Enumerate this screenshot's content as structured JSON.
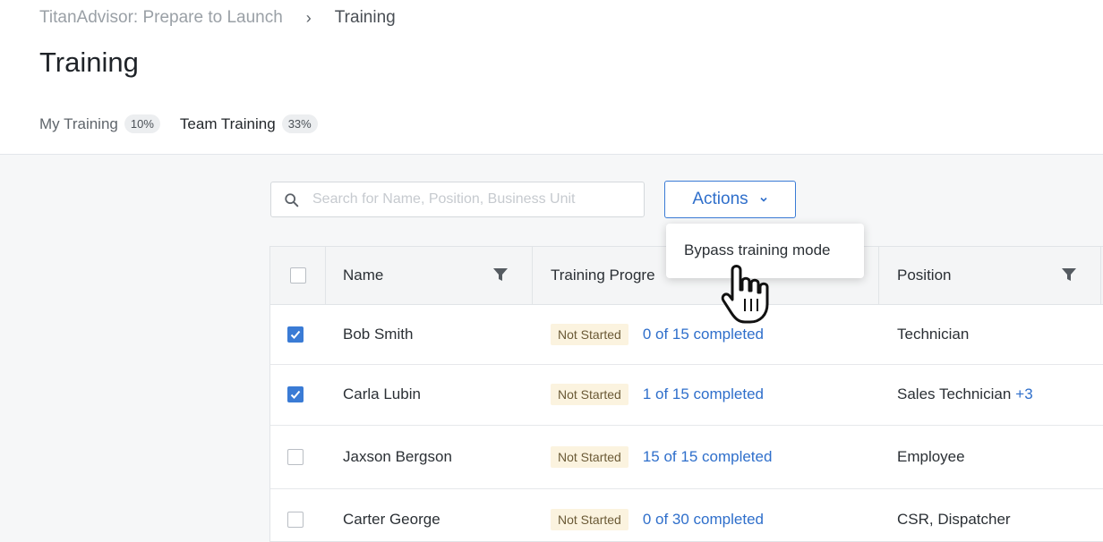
{
  "breadcrumb": {
    "parent": "TitanAdvisor: Prepare to Launch",
    "separator": "›",
    "current": "Training"
  },
  "page_title": "Training",
  "tabs": [
    {
      "label": "My Training",
      "badge": "10%",
      "active": false
    },
    {
      "label": "Team Training",
      "badge": "33%",
      "active": true
    }
  ],
  "search": {
    "placeholder": "Search for Name, Position, Business Unit",
    "value": ""
  },
  "actions": {
    "label": "Actions",
    "menu_items": [
      "Bypass training mode"
    ]
  },
  "table": {
    "columns": [
      "Name",
      "Training Progre",
      "Position"
    ],
    "rows": [
      {
        "checked": true,
        "name": "Bob Smith",
        "status": "Not Started",
        "progress": "0 of 15 completed",
        "position": "Technician",
        "position_extra": ""
      },
      {
        "checked": true,
        "name": "Carla Lubin",
        "status": "Not Started",
        "progress": "1 of 15 completed",
        "position": "Sales Technician",
        "position_extra": "+3"
      },
      {
        "checked": false,
        "name": "Jaxson Bergson",
        "status": "Not Started",
        "progress": "15 of 15 completed",
        "position": "Employee",
        "position_extra": ""
      },
      {
        "checked": false,
        "name": "Carter George",
        "status": "Not Started",
        "progress": "0 of 30 completed",
        "position": "CSR, Dispatcher",
        "position_extra": ""
      }
    ]
  },
  "colors": {
    "accent": "#3a7bd5",
    "link": "#2f6fcb",
    "status_bg": "#fbf3df",
    "content_bg": "#f6f7f8"
  },
  "icons": {
    "search": "search-icon",
    "filter": "filter-icon",
    "chevron": "chevron-down-icon",
    "checkmark": "checkmark-icon",
    "cursor": "hand-pointer-cursor-icon"
  }
}
